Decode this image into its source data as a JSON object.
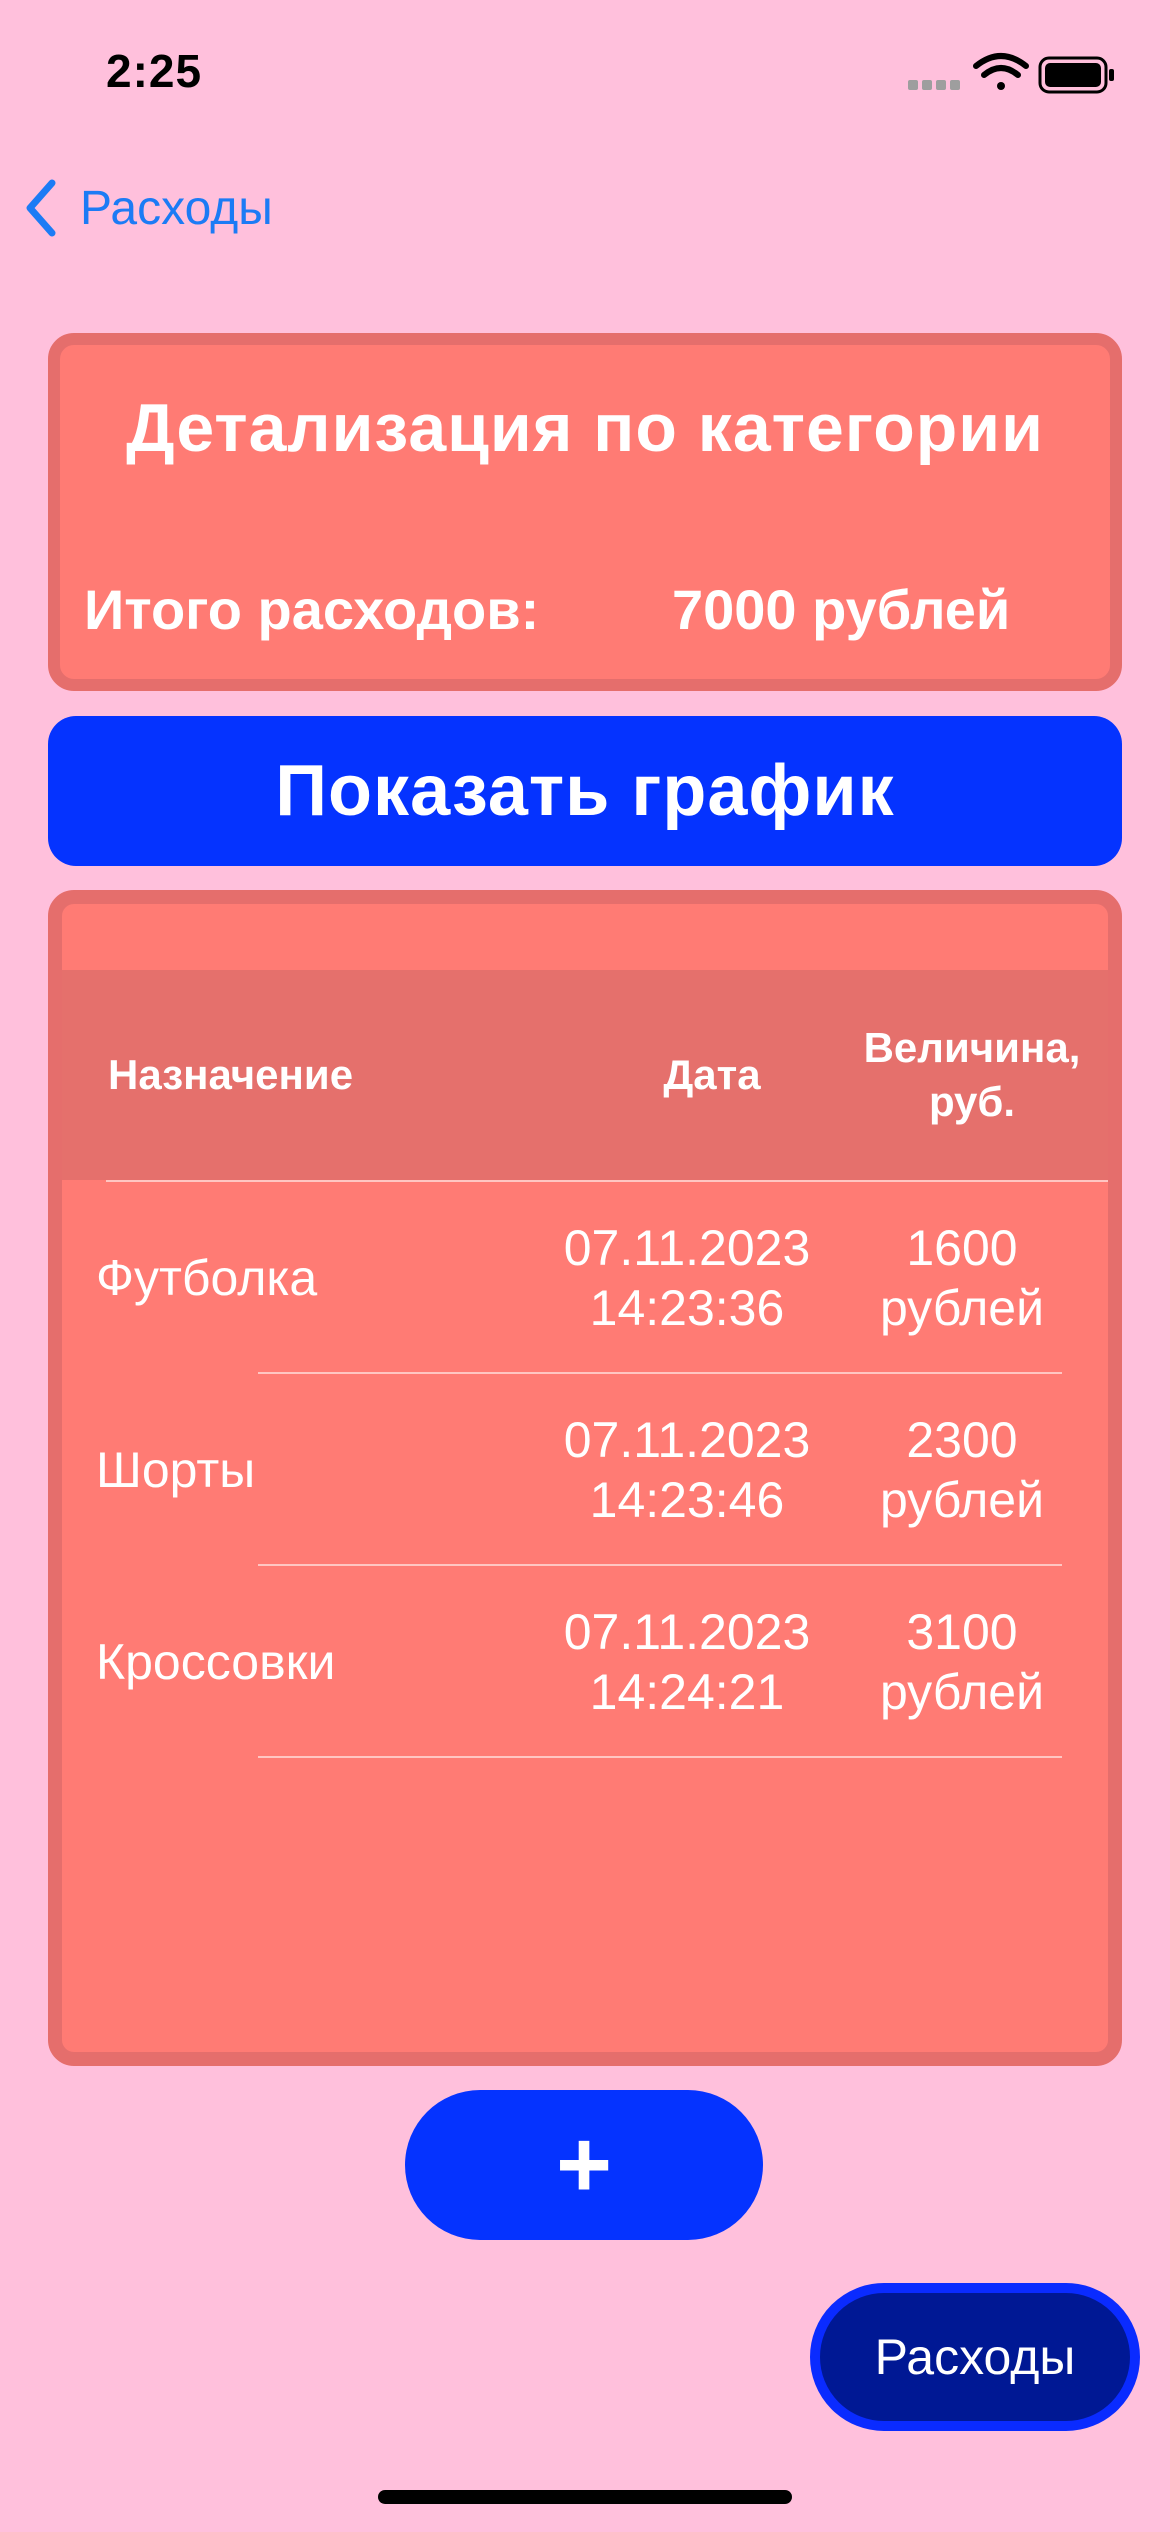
{
  "status_bar": {
    "time": "2:25",
    "icons": [
      "signal-icon",
      "wifi-icon",
      "battery-icon"
    ]
  },
  "nav": {
    "back_label": "Расходы",
    "back_icon": "chevron-left-icon"
  },
  "summary": {
    "title": "Детализация по категории",
    "total_label": "Итого расходов:",
    "total_value": "7000 рублей"
  },
  "chart_button": {
    "label": "Показать график"
  },
  "table": {
    "headers": {
      "purpose": "Назначение",
      "date": "Дата",
      "amount_line1": "Величина,",
      "amount_line2": "руб."
    },
    "rows": [
      {
        "purpose": "Футболка",
        "date": "07.11.2023",
        "time": "14:23:36",
        "amount": "1600",
        "unit": "рублей"
      },
      {
        "purpose": "Шорты",
        "date": "07.11.2023",
        "time": "14:23:46",
        "amount": "2300",
        "unit": "рублей"
      },
      {
        "purpose": "Кроссовки",
        "date": "07.11.2023",
        "time": "14:24:21",
        "amount": "3100",
        "unit": "рублей"
      }
    ]
  },
  "add_button": {
    "label": "+"
  },
  "bottom_button": {
    "label": "Расходы"
  },
  "colors": {
    "background": "#FFC0DC",
    "card": "#FF7B74",
    "card_border": "#E56E6C",
    "accent_blue": "#0533FF",
    "link_blue": "#1C7BF5",
    "dark_blue": "#001894"
  }
}
